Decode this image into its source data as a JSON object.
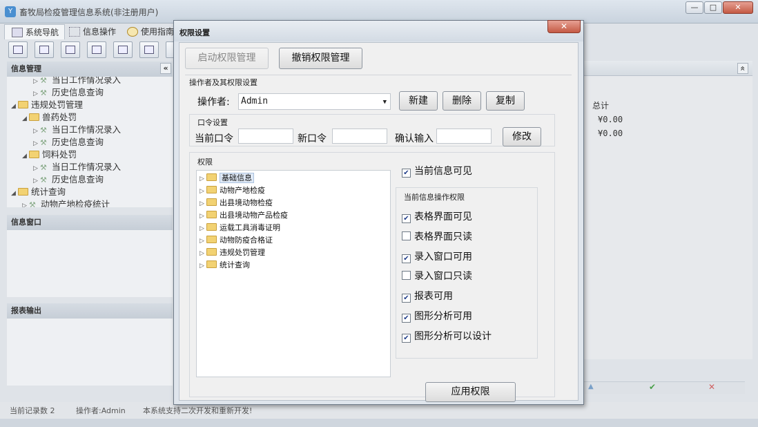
{
  "app": {
    "title": "畜牧局检疫管理信息系统(非注册用户)",
    "window_buttons": [
      "—",
      "□",
      "✕"
    ]
  },
  "menu_tabs": [
    "系统导航",
    "信息操作",
    "使用指南"
  ],
  "left_panel": {
    "info_mgmt_title": "信息管理",
    "collapse_glyph": "«",
    "tree": [
      {
        "label": "当日工作情况录入",
        "level": 3,
        "type": "tool"
      },
      {
        "label": "历史信息查询",
        "level": 3,
        "type": "tool"
      },
      {
        "label": "违规处罚管理",
        "level": 1,
        "type": "folder"
      },
      {
        "label": "兽药处罚",
        "level": 2,
        "type": "folder"
      },
      {
        "label": "当日工作情况录入",
        "level": 3,
        "type": "tool"
      },
      {
        "label": "历史信息查询",
        "level": 3,
        "type": "tool"
      },
      {
        "label": "饲料处罚",
        "level": 2,
        "type": "folder"
      },
      {
        "label": "当日工作情况录入",
        "level": 3,
        "type": "tool"
      },
      {
        "label": "历史信息查询",
        "level": 3,
        "type": "tool"
      },
      {
        "label": "统计查询",
        "level": 1,
        "type": "folder"
      },
      {
        "label": "动物产地检疫统计",
        "level": 2,
        "type": "tool"
      }
    ],
    "info_window_title": "信息窗口",
    "report_output_title": "报表输出"
  },
  "right_panel": {
    "expand_glyph": "«",
    "column_total": "总计",
    "rows": [
      "¥0.00",
      "¥0.00"
    ],
    "footer_icons": [
      "▲",
      "✔",
      "✕"
    ]
  },
  "status_bar": {
    "record_count": "当前记录数 2",
    "operator": "操作者:Admin",
    "notice": "本系统支持二次开发和重新开发!"
  },
  "dialog": {
    "title": "权限设置",
    "close_glyph": "✕",
    "start_button": "启动权限管理",
    "revoke_button": "撤销权限管理",
    "operator_section": "操作者及其权限设置",
    "operator_label": "操作者:",
    "operator_value": "Admin",
    "new_button": "新建",
    "delete_button": "删除",
    "copy_button": "复制",
    "password_section": "口令设置",
    "current_password_label": "当前口令",
    "new_password_label": "新口令",
    "confirm_label": "确认输入",
    "modify_button": "修改",
    "permissions_section": "权限",
    "perm_tree": [
      "基础信息",
      "动物产地检疫",
      "出县境动物检疫",
      "出县境动物产品检疫",
      "运载工具消毒证明",
      "动物防疫合格证",
      "违规处罚管理",
      "统计查询"
    ],
    "current_visible_label": "当前信息可见",
    "current_visible_checked": true,
    "ops_section": "当前信息操作权限",
    "ops": [
      {
        "label": "表格界面可见",
        "checked": true
      },
      {
        "label": "表格界面只读",
        "checked": false
      },
      {
        "label": "录入窗口可用",
        "checked": true
      },
      {
        "label": "录入窗口只读",
        "checked": false
      },
      {
        "label": "报表可用",
        "checked": true
      },
      {
        "label": "图形分析可用",
        "checked": true
      },
      {
        "label": "图形分析可以设计",
        "checked": true
      }
    ],
    "apply_button": "应用权限"
  }
}
